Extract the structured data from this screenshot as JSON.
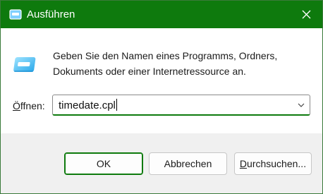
{
  "window": {
    "title": "Ausführen",
    "accent_color": "#0e7a0d"
  },
  "content": {
    "description": "Geben Sie den Namen eines Programms, Ordners, Dokuments oder einer Internetressource an.",
    "open_label": "Öffnen:",
    "open_value": "timedate.cpl"
  },
  "buttons": {
    "ok": "OK",
    "cancel": "Abbrechen",
    "browse_mnemonic": "D",
    "browse_rest": "urchsuchen..."
  },
  "icons": {
    "title": "run-app-icon",
    "dialog": "run-app-icon",
    "close": "close-icon",
    "dropdown": "chevron-down-icon"
  }
}
